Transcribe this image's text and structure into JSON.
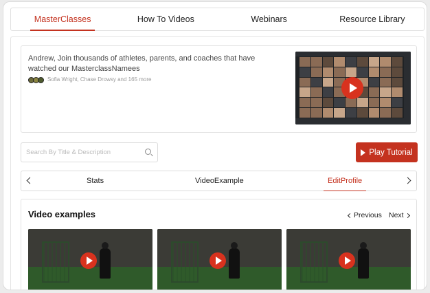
{
  "top_tabs": [
    {
      "label": "MasterClasses",
      "active": true
    },
    {
      "label": "How To Videos",
      "active": false
    },
    {
      "label": "Webinars",
      "active": false
    },
    {
      "label": "Resource Library",
      "active": false
    }
  ],
  "invite": {
    "message": "Andrew, Join thousands of athletes, parents, and coaches that have watched our MasterclassNamees",
    "watchers": "Sofia Wright, Chase Drowsy and 165 more",
    "thumbnail_icon": "play-icon"
  },
  "search": {
    "placeholder": "Search By Title & Description",
    "icon": "search-icon"
  },
  "play_tutorial": {
    "label": "Play Tutorial",
    "icon": "play-icon"
  },
  "sub_tabs": [
    {
      "label": "Stats",
      "active": false
    },
    {
      "label": "VideoExample",
      "active": false
    },
    {
      "label": "EditProfile",
      "active": true
    }
  ],
  "examples": {
    "title": "Video examples",
    "previous_label": "Previous",
    "next_label": "Next",
    "videos": [
      {
        "icon": "play-icon"
      },
      {
        "icon": "play-icon"
      },
      {
        "icon": "play-icon"
      }
    ]
  },
  "colors": {
    "accent": "#c4321f",
    "play_red": "#d8321e",
    "border": "#dcdcdc"
  }
}
